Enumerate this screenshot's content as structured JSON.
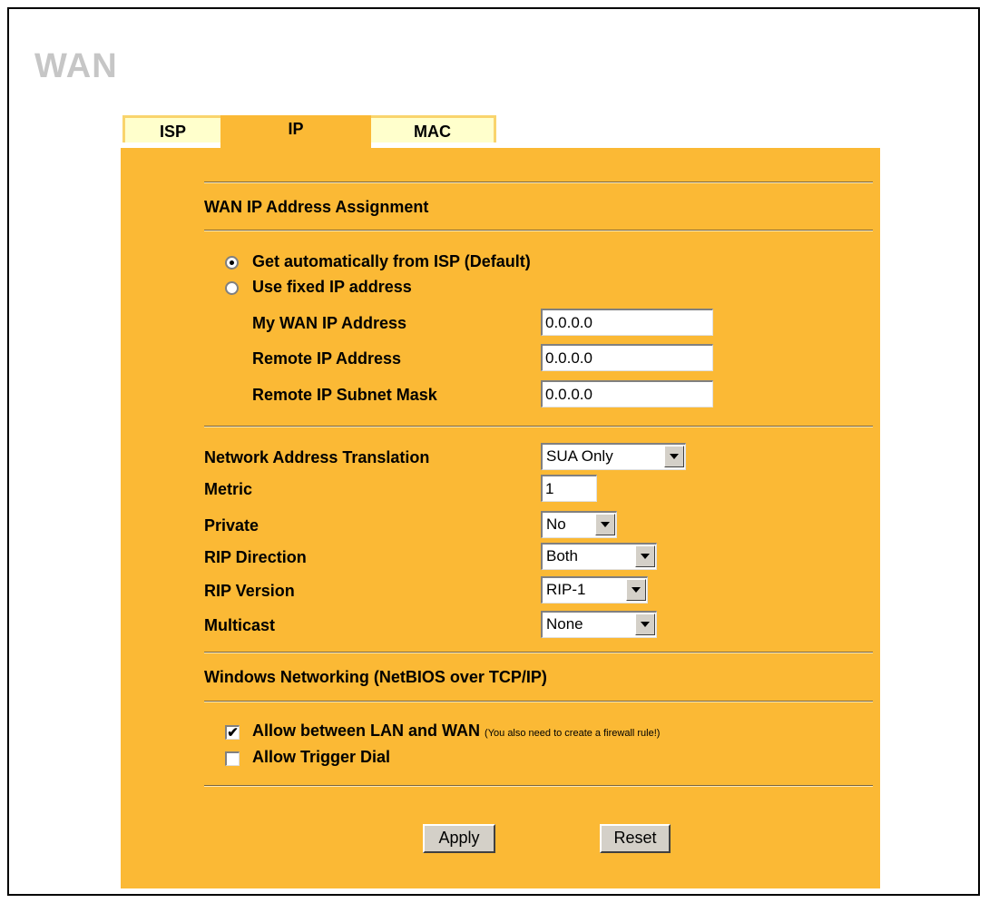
{
  "page": {
    "title": "WAN"
  },
  "tabs": [
    {
      "label": "ISP"
    },
    {
      "label": "IP"
    },
    {
      "label": "MAC"
    }
  ],
  "wan_ip": {
    "heading": "WAN IP Address Assignment",
    "option_auto": "Get automatically from ISP (Default)",
    "option_fixed": "Use fixed IP address",
    "selected": "auto",
    "my_wan_ip_label": "My WAN IP Address",
    "my_wan_ip_value": "0.0.0.0",
    "remote_ip_label": "Remote IP Address",
    "remote_ip_value": "0.0.0.0",
    "remote_mask_label": "Remote IP Subnet Mask",
    "remote_mask_value": "0.0.0.0"
  },
  "settings": {
    "nat_label": "Network Address Translation",
    "nat_value": "SUA Only",
    "metric_label": "Metric",
    "metric_value": "1",
    "private_label": "Private",
    "private_value": "No",
    "rip_direction_label": "RIP Direction",
    "rip_direction_value": "Both",
    "rip_version_label": "RIP Version",
    "rip_version_value": "RIP-1",
    "multicast_label": "Multicast",
    "multicast_value": "None"
  },
  "netbios": {
    "heading": "Windows Networking (NetBIOS over TCP/IP)",
    "allow_lan_wan_label": "Allow between LAN and WAN",
    "allow_lan_wan_note": "(You also need to create a firewall rule!)",
    "allow_lan_wan_checked": true,
    "allow_trigger_label": "Allow Trigger Dial",
    "allow_trigger_checked": false
  },
  "buttons": {
    "apply": "Apply",
    "reset": "Reset"
  },
  "colors": {
    "panel": "#fbb935",
    "tab_inactive": "#ffffcc",
    "title": "#c6c6c6"
  }
}
